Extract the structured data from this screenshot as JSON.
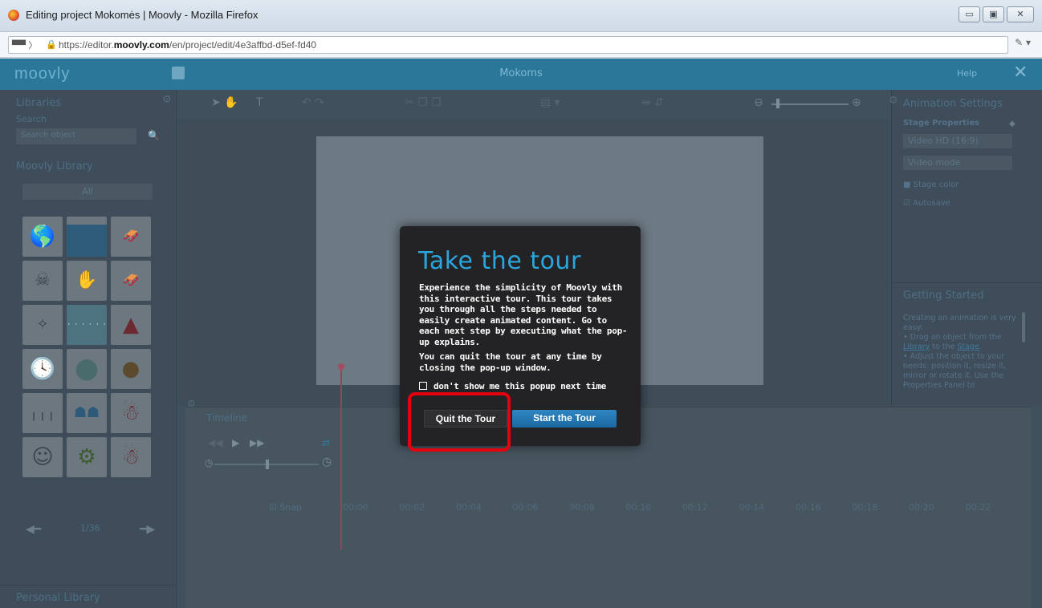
{
  "browser": {
    "window_title": "Editing project Mokomės | Moovly - Mozilla Firefox",
    "url_prefix": "https://editor.",
    "url_domain": "moovly.com",
    "url_path": "/en/project/edit/4e3affbd-d5ef-fd40"
  },
  "app": {
    "logo": "moovly",
    "project_name": "Mokoms",
    "help_label": "Help",
    "close_glyph": "✕"
  },
  "left_panel": {
    "libraries_title": "Libraries",
    "search_label": "Search",
    "search_placeholder": "Search object",
    "moovly_library_title": "Moovly Library",
    "category_select": "All",
    "pager": "1/36",
    "personal_library_title": "Personal Library",
    "tiles": [
      "globe",
      "water",
      "sleigh",
      "skeleton",
      "hand-wash",
      "sleigh",
      "map",
      "dots",
      "santa-hat",
      "clock",
      "circles",
      "sack",
      "rain",
      "people-table",
      "santa",
      "smiley",
      "gears",
      "santa"
    ]
  },
  "right_panel": {
    "title": "Animation Settings",
    "stage_properties": "Stage Properties",
    "resolution": "Video HD (16:9)",
    "video_mode": "Video mode",
    "stage_color": "Stage color",
    "autosave": "Autosave",
    "getting_started_title": "Getting Started",
    "getting_started_intro": "Creating an animation is very easy:",
    "step1_pre": "• Drag an object from the ",
    "step1_link1": "Library",
    "step1_mid": " to the ",
    "step1_link2": "Stage",
    "step1_post": ".",
    "step2": "• Adjust the object to your needs: position it, resize it, mirror or rotate it. Use the Properties Panel to"
  },
  "timeline": {
    "title": "Timeline",
    "snap_label": "Snap",
    "ticks": [
      "00:00",
      "00:02",
      "00:04",
      "00:06",
      "00:08",
      "00:10",
      "00:12",
      "00:14",
      "00:16",
      "00:18",
      "00:20",
      "00:22"
    ]
  },
  "modal": {
    "heading": "Take the tour",
    "paragraph1": "Experience the simplicity of Moovly with this interactive tour.  This tour takes you through all the steps needed to easily create animated content. Go to each next step by executing what the pop-up explains.",
    "paragraph2": "You can quit the tour at any time by closing the pop-up window.",
    "checkbox_label": "don't show me this popup next time",
    "quit_label": "Quit the Tour",
    "start_label": "Start the Tour",
    "highlight_color": "#e5000e"
  }
}
